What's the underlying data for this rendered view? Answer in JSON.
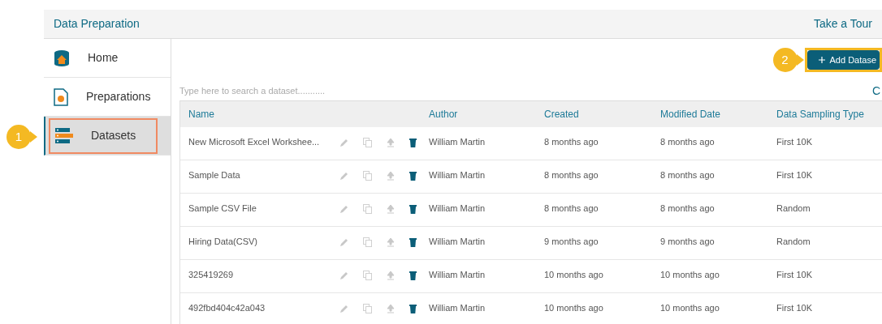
{
  "header": {
    "title": "Data Preparation",
    "tour_link": "Take a Tour"
  },
  "sidebar": {
    "items": [
      {
        "label": "Home",
        "kind": "home",
        "selected": false,
        "highlighted": false
      },
      {
        "label": "Preparations",
        "kind": "preparations",
        "selected": false,
        "highlighted": false
      },
      {
        "label": "Datasets",
        "kind": "datasets",
        "selected": true,
        "highlighted": true
      }
    ]
  },
  "sidebar_callout": {
    "number": "1"
  },
  "add_button": {
    "label": "Add Datase",
    "highlighted": true,
    "callout": "2"
  },
  "search": {
    "placeholder": "Type here to search a dataset..........."
  },
  "edge_text": "C",
  "table": {
    "columns": [
      "Name",
      "Author",
      "Created",
      "Modified Date",
      "Data Sampling Type"
    ],
    "rows": [
      {
        "name": "New Microsoft Excel Workshee...",
        "author": "William Martin",
        "created": "8 months ago",
        "modified": "8 months ago",
        "sampling": "First 10K"
      },
      {
        "name": "Sample Data",
        "author": "William Martin",
        "created": "8 months ago",
        "modified": "8 months ago",
        "sampling": "First 10K"
      },
      {
        "name": "Sample CSV File",
        "author": "William Martin",
        "created": "8 months ago",
        "modified": "8 months ago",
        "sampling": "Random"
      },
      {
        "name": "Hiring Data(CSV)",
        "author": "William Martin",
        "created": "9 months ago",
        "modified": "9 months ago",
        "sampling": "Random"
      },
      {
        "name": "325419269",
        "author": "William Martin",
        "created": "10 months ago",
        "modified": "10 months ago",
        "sampling": "First 10K"
      },
      {
        "name": "492fbd404c42a043",
        "author": "William Martin",
        "created": "10 months ago",
        "modified": "10 months ago",
        "sampling": "First 10K"
      }
    ]
  }
}
